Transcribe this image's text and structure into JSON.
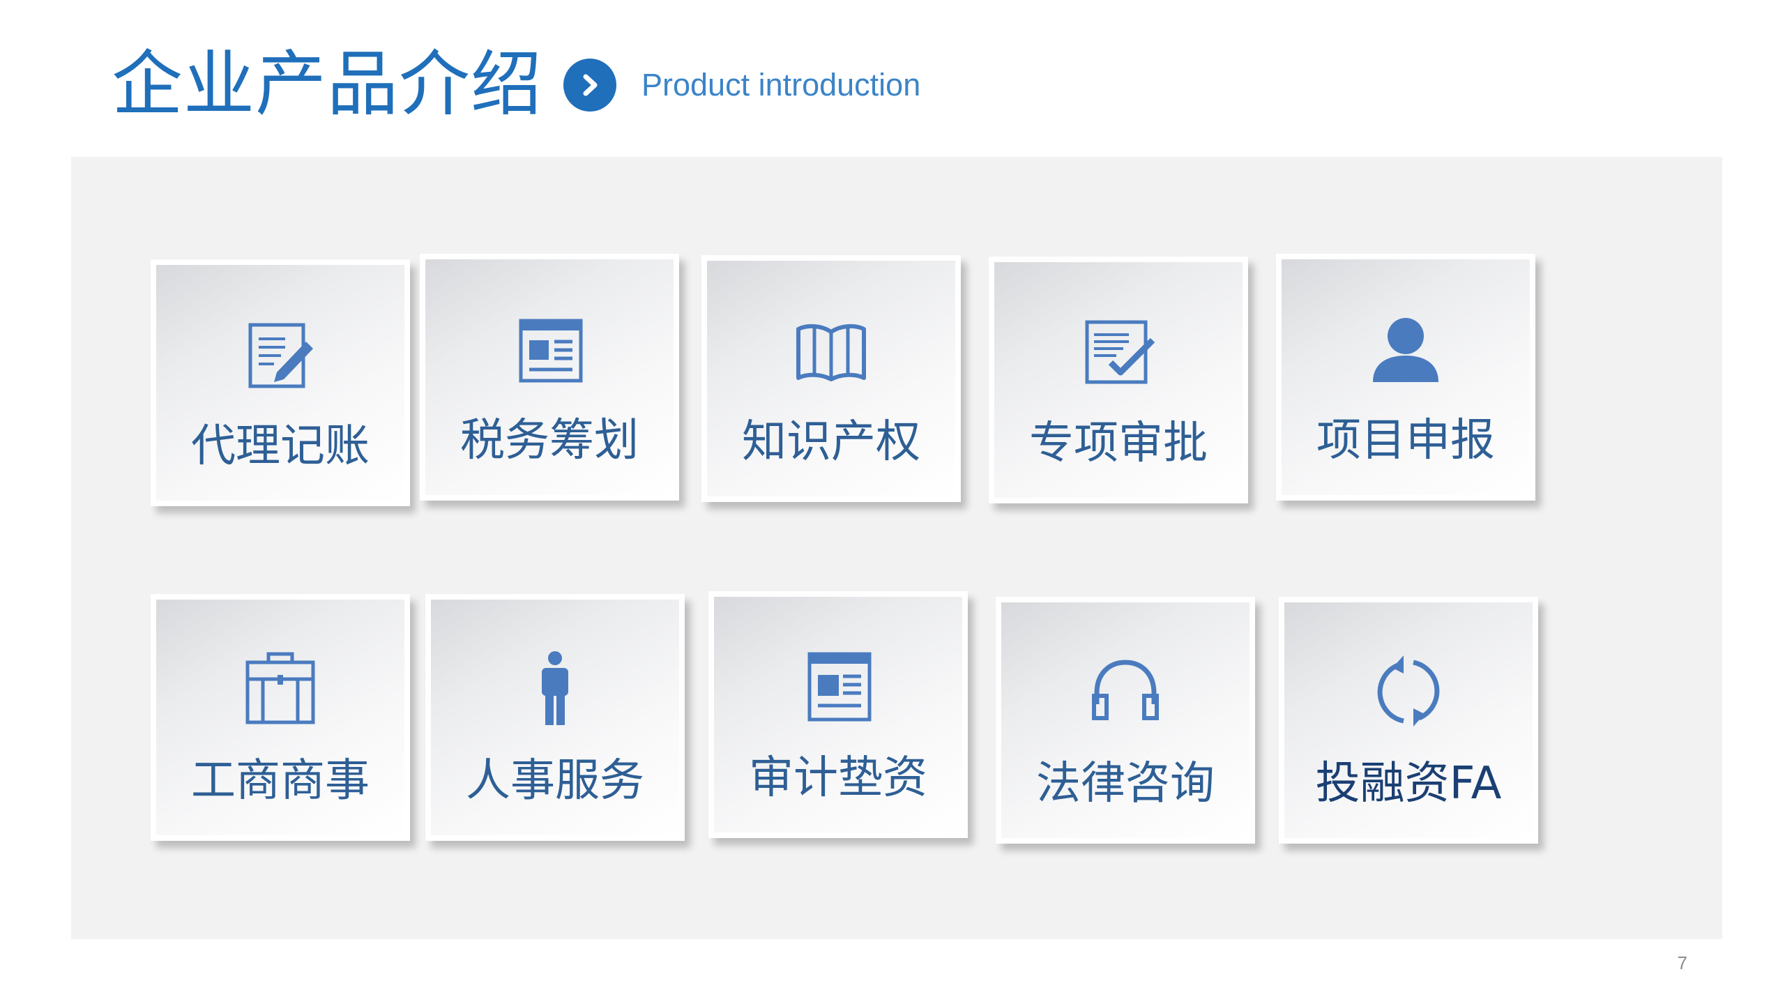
{
  "header": {
    "title": "企业产品介绍",
    "subtitle": "Product introduction"
  },
  "tiles_row1": [
    {
      "label": "代理记账",
      "icon": "edit-document-icon"
    },
    {
      "label": "税务筹划",
      "icon": "newspaper-icon"
    },
    {
      "label": "知识产权",
      "icon": "open-book-icon"
    },
    {
      "label": "专项审批",
      "icon": "checked-document-icon"
    },
    {
      "label": "项目申报",
      "icon": "user-icon"
    }
  ],
  "tiles_row2": [
    {
      "label": "工商商事",
      "icon": "briefcase-icon"
    },
    {
      "label": "人事服务",
      "icon": "person-icon"
    },
    {
      "label": "审计垫资",
      "icon": "newspaper-icon"
    },
    {
      "label": "法律咨询",
      "icon": "headphones-icon"
    },
    {
      "label": "投融资FA",
      "icon": "refresh-icon"
    }
  ],
  "page_number": "7",
  "colors": {
    "accent": "#1f6fba",
    "icon": "#4a7bbf",
    "label": "#2e5f95",
    "panel": "#f2f2f2"
  }
}
